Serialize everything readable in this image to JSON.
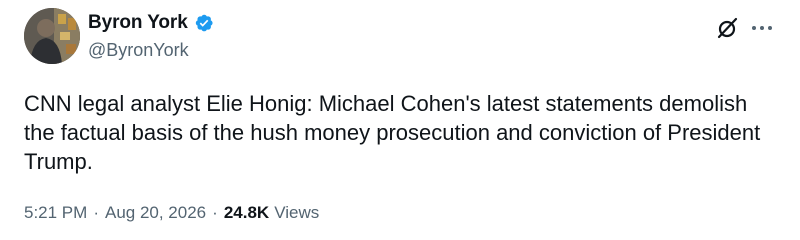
{
  "author": {
    "display_name": "Byron York",
    "handle": "@ByronYork",
    "verified": true
  },
  "tweet": {
    "text": "CNN legal analyst Elie Honig: Michael Cohen's latest statements demolish the factual basis of the hush money prosecution and conviction of President Trump."
  },
  "meta": {
    "time": "5:21 PM",
    "date": "Aug 20, 2026",
    "separator": "·",
    "views_count": "24.8K",
    "views_label": "Views"
  },
  "icons": {
    "verified": "verified-badge-icon",
    "grok": "grok-icon",
    "more": "more-options-icon"
  },
  "colors": {
    "verified_blue": "#1d9bf0",
    "secondary_text": "#536471",
    "primary_text": "#0f1419"
  }
}
